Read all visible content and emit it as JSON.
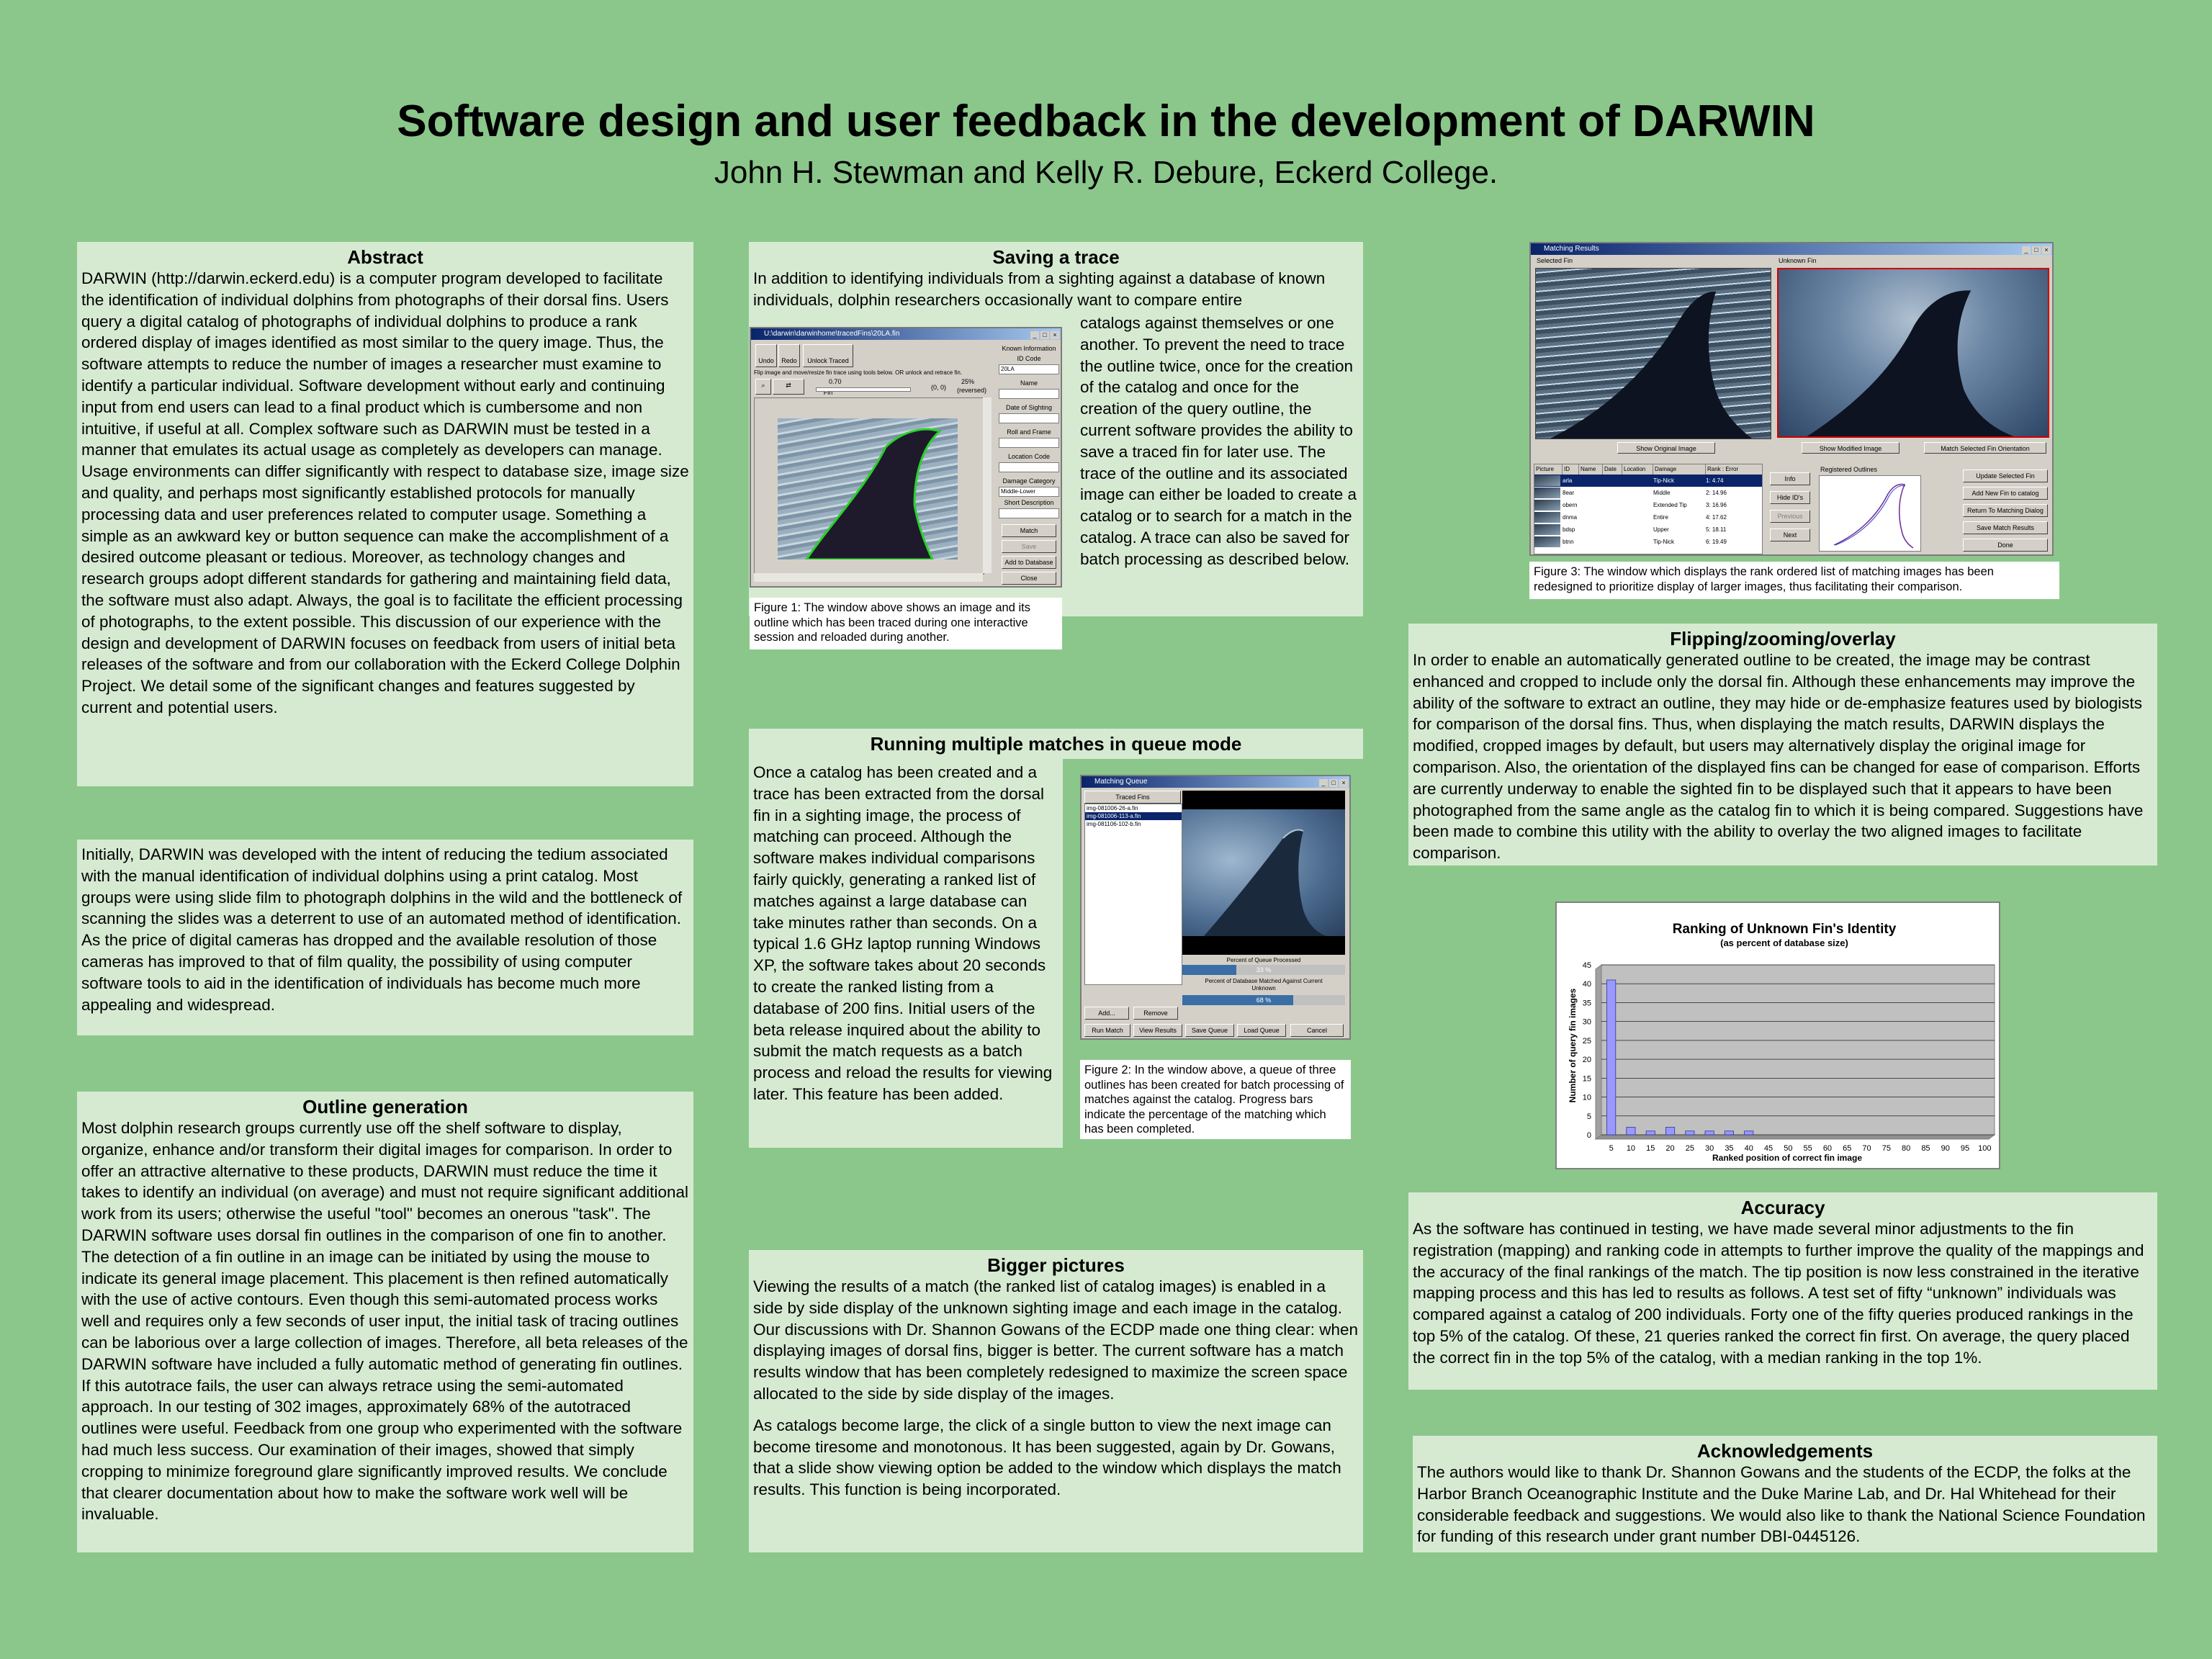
{
  "header": {
    "title": "Software design and user feedback in the development of DARWIN",
    "authors": "John H. Stewman and Kelly R. Debure, Eckerd College."
  },
  "abstract": {
    "heading": "Abstract",
    "text": "DARWIN (http://darwin.eckerd.edu) is a  computer program developed to facilitate the identification of individual  dolphins from photographs of their dorsal fins.  Users query a  digital catalog of photographs of individual dolphins to produce a rank  ordered display of images identified as most similar to the query image.  Thus, the software attempts to reduce the number of images a  researcher must examine to identify a particular individual.  Software development without early and continuing input from end users can lead to a final product which is cumbersome and non intuitive, if useful at all.  Complex software such as DARWIN must be tested in a manner that emulates its actual usage as completely as developers can manage.  Usage environments can differ significantly with respect to database size, image size and quality, and perhaps most significantly established protocols for manually processing data and user preferences related to computer usage.  Something a simple as an awkward key or button sequence can make the accomplishment of a desired outcome pleasant or tedious.  Moreover, as technology changes and research groups adopt  different standards for gathering and maintaining field data, the software  must also adapt. Always,  the goal is to facilitate the efficient processing of photographs, to the  extent possible.  This discussion of our experience with the design and  development of DARWIN  focuses on feedback from users of initial beta releases of the software and from our collaboration with the Eckerd  College Dolphin Project.  We detail some of the significant changes and features suggested by current and potential  users."
  },
  "intro": {
    "text": "Initially, DARWIN was developed with the intent of reducing the tedium associated with the manual identification of individual dolphins using a print catalog.   Most groups were using slide film to photograph dolphins in the wild and the bottleneck of scanning the slides was a deterrent to use of an automated method of identification.   As the price of digital cameras has dropped and the available resolution of those cameras has improved to that of film quality, the possibility of using computer software tools to aid in the identification of individuals has become much more appealing and widespread."
  },
  "outline": {
    "heading": "Outline generation",
    "text": "Most dolphin research groups currently use off the shelf software to display, organize, enhance and/or transform their digital images for comparison.  In order to offer an attractive alternative to these products, DARWIN must reduce the time it takes to identify an individual (on average) and must not require significant additional work from its users; otherwise the useful \"tool\" becomes an onerous \"task\".  The DARWIN software uses dorsal fin outlines in the comparison of one fin to another.  The detection of a fin outline in an image can be initiated by using the mouse to indicate its general image placement.  This placement is then refined automatically with the use of active contours.  Even though this semi-automated process works well and requires only a few seconds of user input, the initial task of tracing outlines can be laborious over a large collection of images.  Therefore, all beta releases of the DARWIN software have included a fully automatic method of generating fin outlines.  If this autotrace fails, the user can always retrace using the semi-automated approach.  In our testing of 302 images, approximately 68% of the autotraced outlines were useful.  Feedback from one group who experimented with the software had much less success. Our examination of their images, showed that simply cropping to minimize foreground glare significantly improved results.  We conclude that clearer documentation about how to make the software work well will be invaluable."
  },
  "saving": {
    "heading": "Saving a trace",
    "text_top": "In addition to identifying individuals from a sighting against a database of known individuals, dolphin researchers occasionally want to compare entire",
    "text_right": "catalogs against themselves or one another.  To prevent the need to trace the outline twice, once for the creation of the catalog and once for the creation of the query outline, the current software provides the ability to save a traced fin for later use.  The trace of the outline and its associated image can either be loaded to create a catalog or to search for a match in the catalog.  A trace can also be saved for batch processing as described below.",
    "figure_caption": "Figure 1:  The window above shows an image and its outline which has been traced during one interactive session and reloaded during another."
  },
  "fig1": {
    "window_title": "U:\\darwin\\darwinhome\\tracedFins\\20LA.fin",
    "toolbar": [
      "Undo",
      "Redo",
      "Unlock Traced Fin"
    ],
    "hint": "Flip image and move/resize fin trace using tools below. OR unlock and retrace fin.",
    "zoom": "0.70",
    "coords": "(0, 0)",
    "pct": "25%",
    "pct2": "(reversed)",
    "known_info": "Known Information",
    "id_code_label": "ID Code",
    "id_code_value": "20LA",
    "fields": [
      "Name",
      "Date of Sighting",
      "Roll and Frame",
      "Location Code",
      "Damage Category"
    ],
    "damage_value": "Middle-Lower",
    "short_desc": "Short Description",
    "buttons": [
      "Match",
      "Save",
      "Add to Database",
      "Close"
    ]
  },
  "queue": {
    "heading": "Running multiple matches in queue mode",
    "text": "Once a catalog has been created and a trace has been extracted from the dorsal fin in a sighting image, the process of matching can proceed. Although the software makes individual comparisons fairly quickly, generating a ranked list of matches against a large database can take minutes rather than seconds.  On a typical 1.6 GHz laptop running Windows XP, the software takes about 20 seconds to create the ranked listing from a database of 200 fins. Initial users of the beta release inquired about the ability to submit the match requests as a batch process and reload the results for viewing later.  This feature has been added.",
    "figure_caption": "Figure 2:  In the window above, a queue of three outlines has been created for batch processing of matches against the catalog.  Progress bars indicate the percentage of the matching which has been completed."
  },
  "fig2": {
    "window_title": "Matching Queue",
    "list_header": "Traced Fins",
    "items": [
      "img-081006-26-a.fin",
      "img-081006-113-a.fin",
      "img-081106-102-b.fin"
    ],
    "progress1_label": "Percent of Queue Processed",
    "progress1_value": "33 %",
    "progress1_fraction": 0.33,
    "progress2_label": "Percent of Database Matched Against Current Unknown",
    "progress2_value": "68 %",
    "progress2_fraction": 0.68,
    "buttons_row1": [
      "Add...",
      "Remove"
    ],
    "buttons_row2": [
      "Run Match",
      "View Results",
      "Save Queue",
      "Load Queue",
      "Cancel"
    ]
  },
  "bigger": {
    "heading": "Bigger pictures",
    "p1": "Viewing the results of a match (the ranked list of catalog images) is enabled in a side by side display of the unknown sighting image and each image in the catalog.  Our discussions with Dr. Shannon Gowans of the ECDP made one thing clear: when displaying images of dorsal fins, bigger is better.  The current software has a match results window that has been completely redesigned to maximize the screen space allocated to the side by side display of the images.",
    "p2": "As catalogs become large, the click of a single button to view the next image can become tiresome and monotonous.  It has been suggested, again by Dr. Gowans, that a slide show viewing option be added to the window which displays the match results. This function is being incorporated."
  },
  "fig3": {
    "window_title": "Matching Results",
    "selected_label": "Selected Fin",
    "unknown_label": "Unknown Fin",
    "btn_show_original": "Show Original Image",
    "btn_show_modified": "Show Modified Image",
    "btn_match_orientation": "Match Selected Fin Orientation",
    "columns": [
      "Picture",
      "ID",
      "Name",
      "Date",
      "Location",
      "Damage",
      "Rank : Error"
    ],
    "rows": [
      {
        "id": "arla",
        "damage": "Tip-Nick",
        "rank": "1:  4.74"
      },
      {
        "id": "8ear",
        "damage": "Middle",
        "rank": "2:  14.96"
      },
      {
        "id": "oberm",
        "damage": "Extended Tip",
        "rank": "3:  16.96"
      },
      {
        "id": "dnma",
        "damage": "Entire",
        "rank": "4:  17.62"
      },
      {
        "id": "bdsp",
        "damage": "Upper",
        "rank": "5:  18.11"
      },
      {
        "id": "btnn",
        "damage": "Tip-Nick",
        "rank": "6:  19.49"
      }
    ],
    "mid_buttons": [
      "Info",
      "Hide ID's",
      "Previous",
      "Next"
    ],
    "outlines_label": "Registered Outlines",
    "right_buttons": [
      "Update Selected Fin",
      "Add New Fin to catalog",
      "Return To Matching Dialog",
      "Save Match Results",
      "Done"
    ],
    "figure_caption": "Figure 3:  The window which displays the rank ordered list of matching images has been redesigned to prioritize display of larger images, thus facilitating their comparison."
  },
  "flipping": {
    "heading": "Flipping/zooming/overlay",
    "text": "In order to enable an automatically generated outline to be created, the image may be contrast enhanced and cropped to include only the dorsal fin. Although these enhancements may improve the ability of the software to extract an outline, they may hide or de-emphasize features used by biologists for comparison of the dorsal fins.  Thus, when displaying the match results, DARWIN displays the modified, cropped images by default, but users may alternatively display the original image for comparison.  Also, the orientation of the displayed fins can be changed for ease of comparison.  Efforts are currently underway to enable the sighted fin to be displayed such that it appears to have been photographed from the same angle as the catalog fin to which it is being compared. Suggestions have been made to combine this utility with the ability to overlay the two aligned images to facilitate comparison."
  },
  "chart_data": {
    "type": "bar",
    "title": "Ranking of Unknown Fin's Identity",
    "subtitle": "(as percent of database size)",
    "xlabel": "Ranked position of correct fin image",
    "ylabel": "Number of query fin images",
    "categories": [
      "5",
      "10",
      "15",
      "20",
      "25",
      "30",
      "35",
      "40",
      "45",
      "50",
      "55",
      "60",
      "65",
      "70",
      "75",
      "80",
      "85",
      "90",
      "95",
      "100"
    ],
    "values": [
      41,
      2,
      1,
      2,
      1,
      1,
      1,
      1,
      0,
      0,
      0,
      0,
      0,
      0,
      0,
      0,
      0,
      0,
      0,
      0
    ],
    "yticks": [
      "0",
      "5",
      "10",
      "15",
      "20",
      "25",
      "30",
      "35",
      "40",
      "45"
    ],
    "ylim": [
      0,
      45
    ],
    "grid": true,
    "colors": {
      "bar": "#9999ff",
      "plot_bg": "#c0c0c0"
    }
  },
  "accuracy": {
    "heading": "Accuracy",
    "text": "As the software has continued in testing, we have made several minor adjustments to the fin registration (mapping) and ranking code in attempts to further improve the quality of the mappings and the accuracy of the final rankings of the match.  The tip position is now less constrained in the iterative mapping process and this has led to results as follows. A test set of fifty “unknown” individuals was compared against a catalog of 200 individuals.  Forty one of the fifty queries produced rankings in the top 5% of the catalog.  Of these, 21 queries ranked the correct fin first.  On average, the query placed the correct fin in the top 5% of the catalog, with a median ranking in the top 1%."
  },
  "ack": {
    "heading": "Acknowledgements",
    "text": "The authors would like to thank Dr. Shannon Gowans and the students of the ECDP, the folks at the Harbor Branch Oceanographic Institute and the Duke Marine Lab, and Dr. Hal Whitehead for their considerable feedback and suggestions.  We would also like to thank the National Science Foundation for funding of this research under grant number DBI-0445126."
  },
  "colors": {
    "background": "#8bc78b",
    "panel": "#d6ead2"
  }
}
